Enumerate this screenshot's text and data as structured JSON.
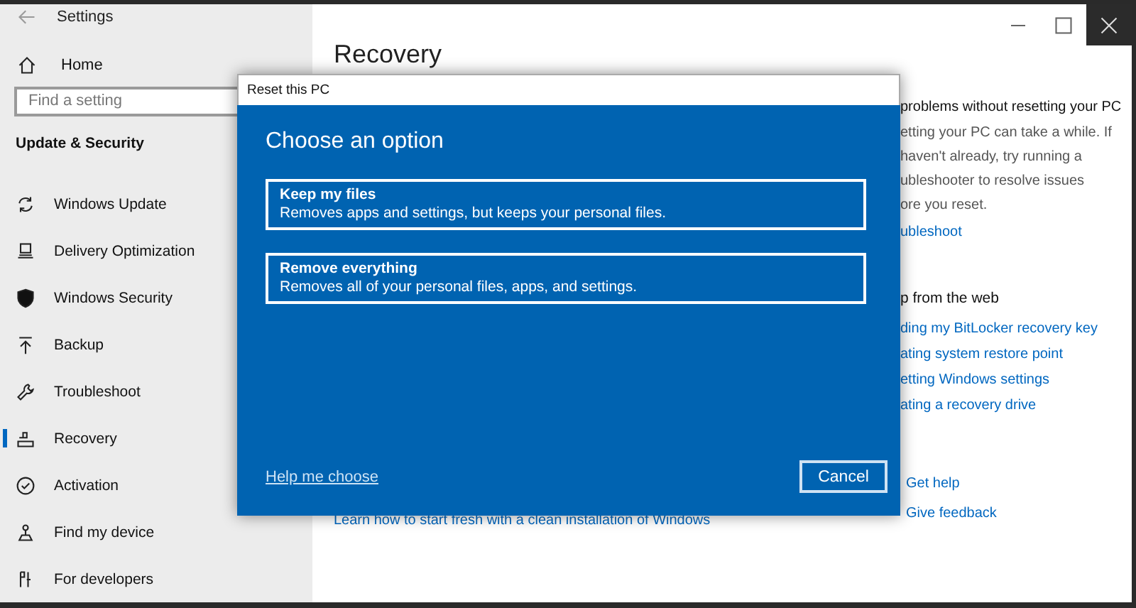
{
  "window": {
    "title": "Settings"
  },
  "sidebar": {
    "home": "Home",
    "search": {
      "placeholder": "Find a setting"
    },
    "section": "Update & Security",
    "items": [
      {
        "label": "Windows Update",
        "selected": false
      },
      {
        "label": "Delivery Optimization",
        "selected": false
      },
      {
        "label": "Windows Security",
        "selected": false
      },
      {
        "label": "Backup",
        "selected": false
      },
      {
        "label": "Troubleshoot",
        "selected": false
      },
      {
        "label": "Recovery",
        "selected": true
      },
      {
        "label": "Activation",
        "selected": false
      },
      {
        "label": "Find my device",
        "selected": false
      },
      {
        "label": "For developers",
        "selected": false
      }
    ]
  },
  "main": {
    "title": "Recovery",
    "bottom_link": "Learn how to start fresh with a clean installation of Windows",
    "side": {
      "heading": "problems without resetting your PC",
      "body_lines": [
        "etting your PC can take a while. If",
        "haven't already, try running a",
        "ubleshooter to resolve issues",
        "ore you reset."
      ],
      "link": "ubleshoot",
      "web_heading": "p from the web",
      "web_links": [
        "ding my BitLocker recovery key",
        "ating system restore point",
        "etting Windows settings",
        "ating a recovery drive"
      ],
      "help_links": [
        "Get help",
        "Give feedback"
      ]
    }
  },
  "dialog": {
    "title": "Reset this PC",
    "heading": "Choose an option",
    "options": [
      {
        "title": "Keep my files",
        "description": "Removes apps and settings, but keeps your personal files."
      },
      {
        "title": "Remove everything",
        "description": "Removes all of your personal files, apps, and settings."
      }
    ],
    "help_link": "Help me choose",
    "cancel": "Cancel"
  }
}
